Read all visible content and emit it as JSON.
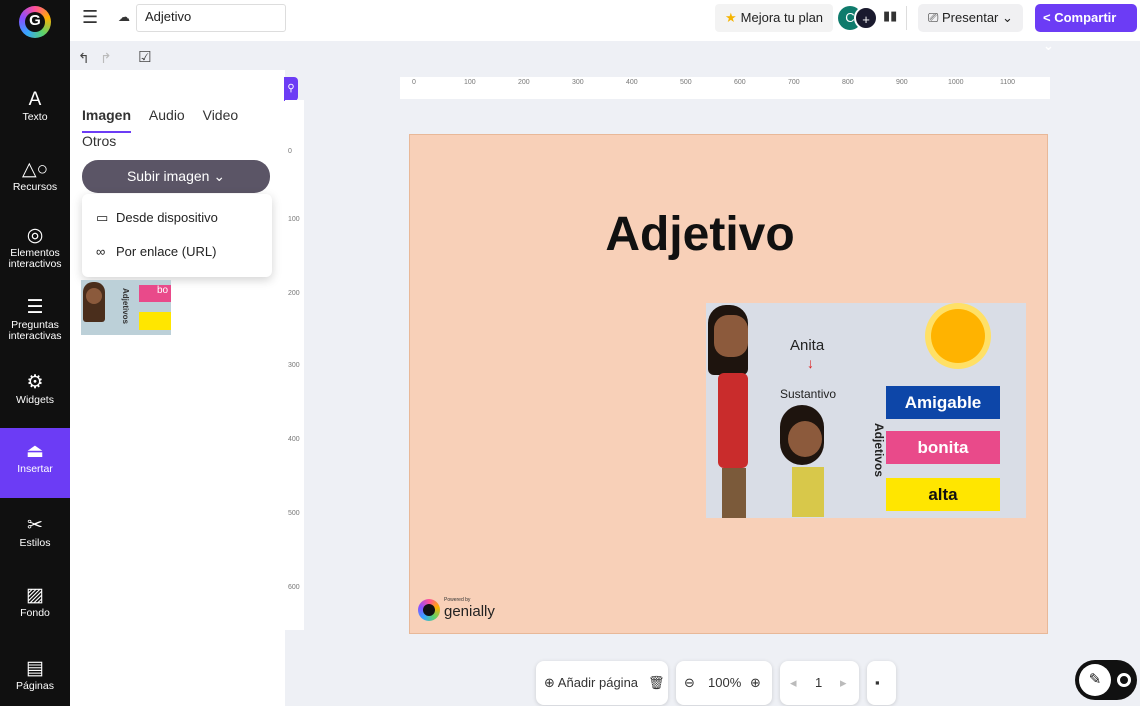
{
  "rail": {
    "items": [
      {
        "icon": "A",
        "label": "Texto"
      },
      {
        "icon": "△○",
        "label": "Recursos"
      },
      {
        "icon": "◎",
        "label": "Elementos interactivos"
      },
      {
        "icon": "☰",
        "label": "Preguntas interactivas"
      },
      {
        "icon": "⚙",
        "label": "Widgets"
      },
      {
        "icon": "⏏",
        "label": "Insertar"
      },
      {
        "icon": "✂",
        "label": "Estilos"
      },
      {
        "icon": "▨",
        "label": "Fondo"
      },
      {
        "icon": "▤",
        "label": "Páginas"
      }
    ]
  },
  "topbar": {
    "doc_title": "Adjetivo",
    "upgrade_label": "Mejora tu plan",
    "avatar1": "C",
    "present_label": "Presentar",
    "share_label": "Compartir"
  },
  "panel": {
    "tabs": [
      "Imagen",
      "Audio",
      "Video",
      "Otros"
    ],
    "upload_label": "Subir imagen",
    "menu": [
      "Desde dispositivo",
      "Por enlace (URL)"
    ],
    "thumb_word": "bo",
    "thumb_vertical": "Adjetivos"
  },
  "ruler": {
    "top": [
      "0",
      "100",
      "200",
      "300",
      "400",
      "500",
      "600",
      "700",
      "800",
      "900",
      "1000",
      "1100"
    ],
    "left": [
      "0",
      "100",
      "200",
      "300",
      "400",
      "500",
      "600"
    ]
  },
  "slide": {
    "title": "Adjetivo",
    "name": "Anita",
    "arrow": "↓",
    "noun_label": "Sustantivo",
    "vertical_label": "Adjetivos",
    "adjectives": [
      "Amigable",
      "bonita",
      "alta"
    ],
    "powered_by": "Powered by",
    "brand": "genially"
  },
  "bottom": {
    "add_page": "Añadir página",
    "zoom": "100%",
    "page": "1"
  },
  "colors": {
    "accent": "#6c3cf5",
    "slide_bg": "#f8d0b8",
    "adj1": "#0d46a8",
    "adj2": "#e94a8a",
    "adj3": "#ffe600"
  }
}
